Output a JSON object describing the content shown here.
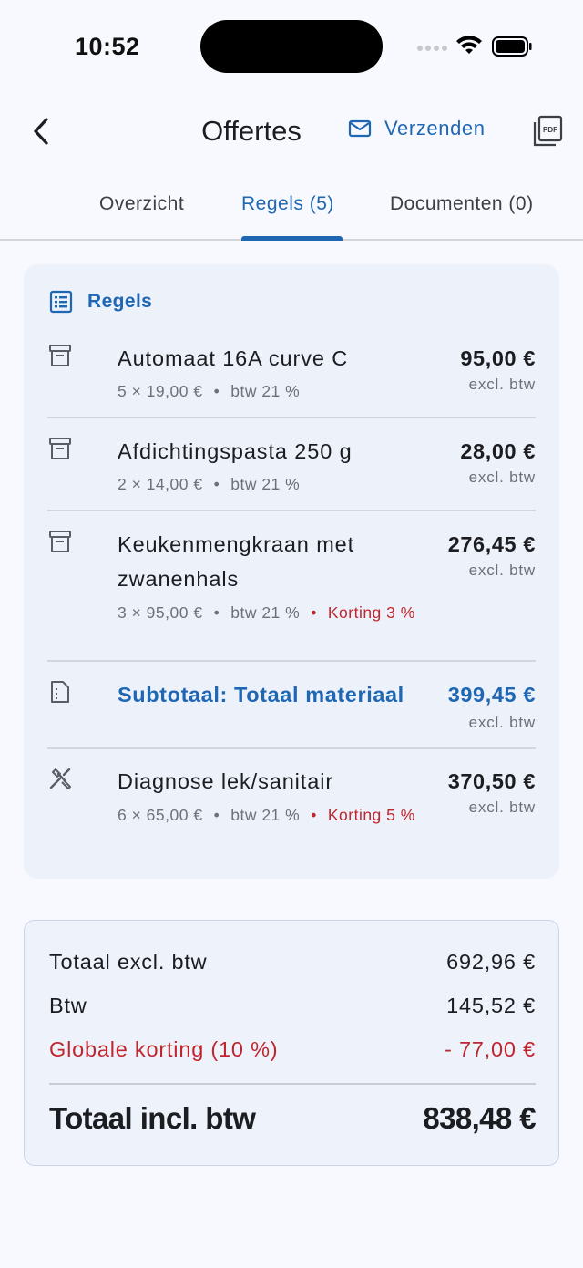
{
  "status_bar": {
    "time": "10:52"
  },
  "app_bar": {
    "title": "Offertes",
    "send_label": "Verzenden"
  },
  "tabs": [
    {
      "label": "Overzicht"
    },
    {
      "label": "Regels (5)"
    },
    {
      "label": "Documenten (0)"
    }
  ],
  "lines_card": {
    "heading": "Regels",
    "rows": [
      {
        "icon": "box-icon",
        "name": "Automaat 16A curve C",
        "qty_price": "5 × 19,00 €",
        "vat": "btw 21 %",
        "discount": "",
        "amount": "95,00 €",
        "tax_note": "excl. btw"
      },
      {
        "icon": "box-icon",
        "name": "Afdichtingspasta 250 g",
        "qty_price": "2 × 14,00 €",
        "vat": "btw 21 %",
        "discount": "",
        "amount": "28,00 €",
        "tax_note": "excl. btw"
      },
      {
        "icon": "box-icon",
        "name": "Keukenmengkraan met zwanenhals",
        "qty_price": "3 × 95,00 €",
        "vat": "btw 21 %",
        "discount": "Korting 3 %",
        "amount": "276,45 €",
        "tax_note": "excl. btw"
      },
      {
        "icon": "receipt-icon",
        "name": "Subtotaal: Totaal materiaal",
        "amount": "399,45 €",
        "tax_note": "excl. btw"
      },
      {
        "icon": "tools-icon",
        "name": "Diagnose lek/sanitair",
        "qty_price": "6 × 65,00 €",
        "vat": "btw 21 %",
        "discount": "Korting 5 %",
        "amount": "370,50 €",
        "tax_note": "excl. btw"
      }
    ]
  },
  "totals": {
    "excl_label": "Totaal excl. btw",
    "excl_value": "692,96 €",
    "vat_label": "Btw",
    "vat_value": "145,52 €",
    "discount_label": "Globale korting (10 %)",
    "discount_value": "- 77,00 €",
    "grand_label": "Totaal incl. btw",
    "grand_value": "838,48 €"
  },
  "colors": {
    "accent": "#1f66b3",
    "danger": "#c0262d",
    "card_bg": "#edf1fa"
  }
}
